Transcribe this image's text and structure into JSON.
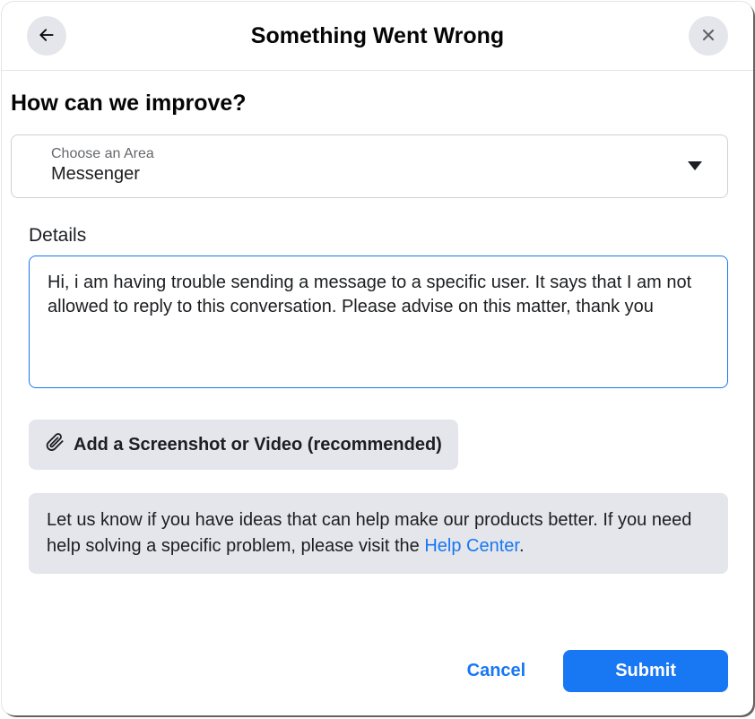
{
  "header": {
    "title": "Something Went Wrong"
  },
  "body": {
    "subheading": "How can we improve?",
    "area": {
      "label": "Choose an Area",
      "value": "Messenger"
    },
    "details_label": "Details",
    "details_value": "Hi, i am having trouble sending a message to a specific user. It says that I am not allowed to reply to this conversation. Please advise on this matter, thank you",
    "attach_label": "Add a Screenshot or Video (recommended)",
    "info_text_1": "Let us know if you have ideas that can help make our products better. If you need help solving a specific problem, please visit the ",
    "info_link": "Help Center",
    "info_text_2": "."
  },
  "footer": {
    "cancel": "Cancel",
    "submit": "Submit"
  }
}
